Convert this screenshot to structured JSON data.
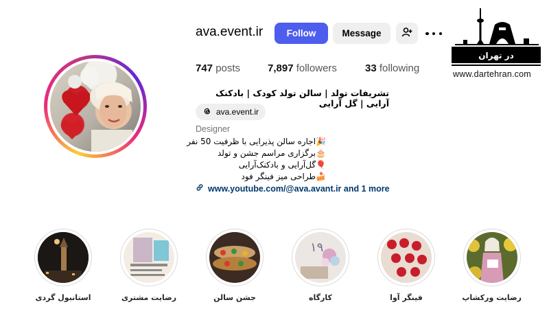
{
  "profile": {
    "username": "ava.event.ir",
    "follow_label": "Follow",
    "message_label": "Message",
    "stats": {
      "posts_count": "747",
      "posts_label": "posts",
      "followers_count": "7,897",
      "followers_label": "followers",
      "following_count": "33",
      "following_label": "following"
    },
    "bio_name": "تشریفات تولد | سالن تولد کودک | بادکنک آرایی | گل آرایی",
    "threads_handle": "ava.event.ir",
    "category": "Designer",
    "bio_lines": [
      "🎉اجاره سالن پذیرایی با ظرفیت 50 نفر",
      "🎂برگزاری مراسم جشن و تولد",
      "🎈گل‌آرایی و بادکنک‌آرایی",
      "🍰طراحی میز فینگر فود"
    ],
    "link_text": "www.youtube.com/@ava.avant.ir and 1 more"
  },
  "watermark": {
    "logo_text": "در تهران",
    "site": "www.dartehran.com"
  },
  "highlights": [
    {
      "label": "استانبول گردی"
    },
    {
      "label": "رضایت مشتری"
    },
    {
      "label": "جشن سالن"
    },
    {
      "label": "کارگاه"
    },
    {
      "label": "فینگر آوا"
    },
    {
      "label": "رضایت ورکشاپ"
    }
  ],
  "colors": {
    "follow_button": "#4d5ded",
    "secondary_button": "#efefef",
    "link": "#00376b",
    "muted_text": "#737373"
  }
}
